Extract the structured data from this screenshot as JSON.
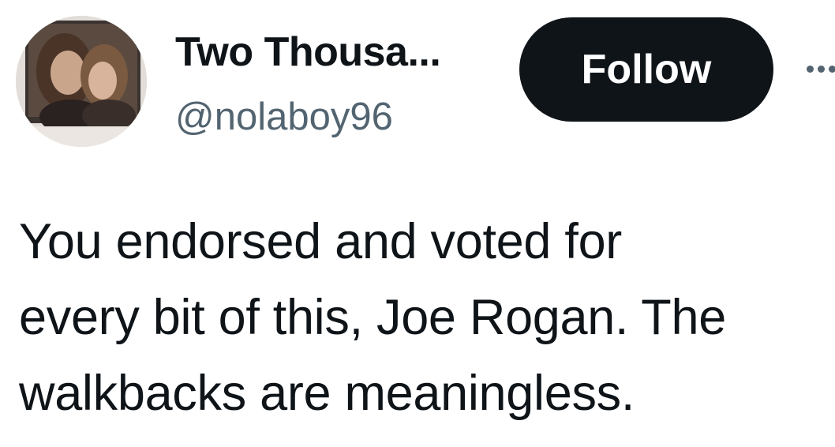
{
  "author": {
    "display_name": "Two Thousa...",
    "handle": "@nolaboy96",
    "avatar_icon": "profile-photo"
  },
  "actions": {
    "follow_label": "Follow",
    "more_icon": "more-horizontal-icon"
  },
  "tweet": {
    "text": "You endorsed and voted for\nevery bit of this, Joe Rogan. The\nwalkbacks are meaningless."
  },
  "colors": {
    "text_primary": "#0f1419",
    "text_secondary": "#536471",
    "follow_bg": "#0f1419",
    "follow_text": "#ffffff",
    "background": "#ffffff"
  }
}
